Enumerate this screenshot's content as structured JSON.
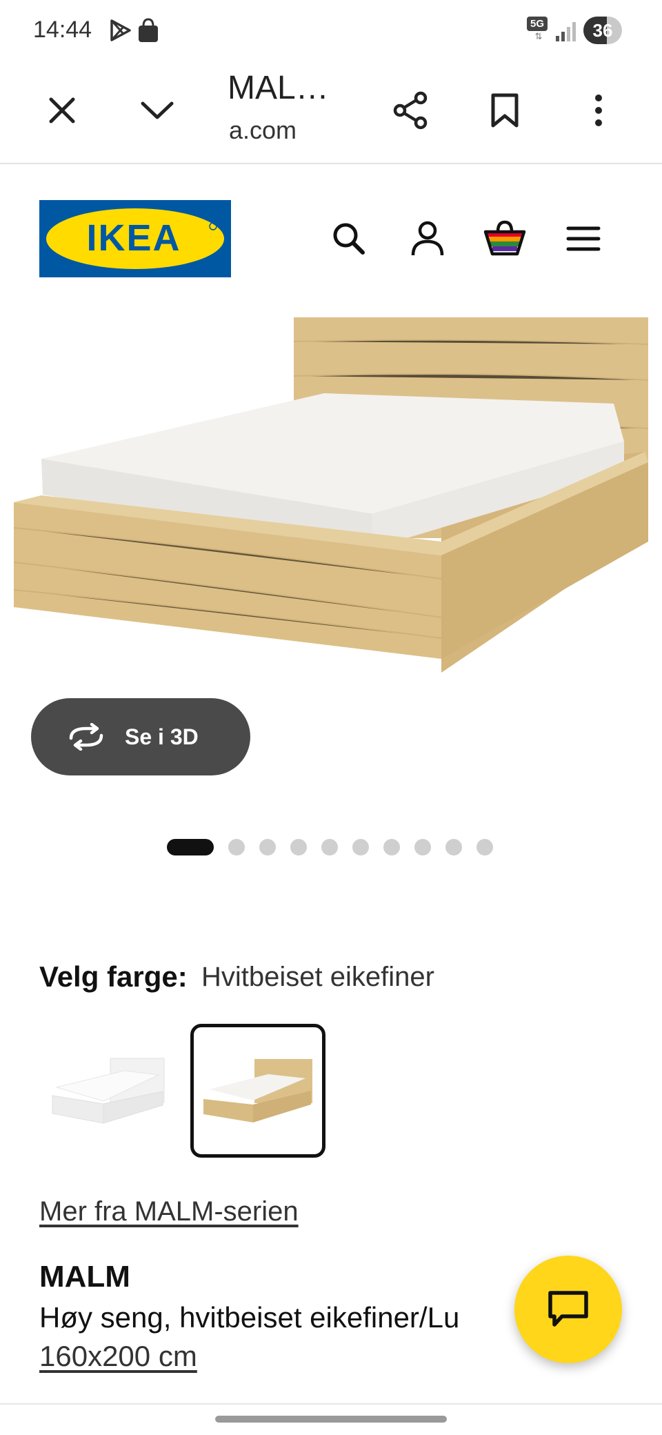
{
  "status_bar": {
    "time": "14:44",
    "network": "5G",
    "battery": "36"
  },
  "browser": {
    "title": "MAL…",
    "domain": "a.com",
    "icons": [
      "close-icon",
      "chevron-down-icon",
      "share-icon",
      "bookmark-icon",
      "more-vert-icon"
    ]
  },
  "header": {
    "logo_text": "IKEA",
    "brand_colors": {
      "blue": "#0058A3",
      "yellow": "#FFDB00"
    },
    "icons": [
      "search-icon",
      "account-icon",
      "cart-icon",
      "menu-icon"
    ]
  },
  "gallery": {
    "view_3d_label": "Se i 3D",
    "dots_total": 10,
    "active_dot": 1
  },
  "color_picker": {
    "label": "Velg farge:",
    "selected": "Hvitbeiset eikefiner",
    "options": [
      "white",
      "white-stained-oak"
    ]
  },
  "product": {
    "series_link": "Mer fra MALM-serien",
    "name": "MALM",
    "description": "Høy seng, hvitbeiset eikefiner/Lu",
    "size": "160x200 cm"
  },
  "colors": {
    "chat_fab": "#FFD61A",
    "button_dark": "#4A4A4A"
  }
}
